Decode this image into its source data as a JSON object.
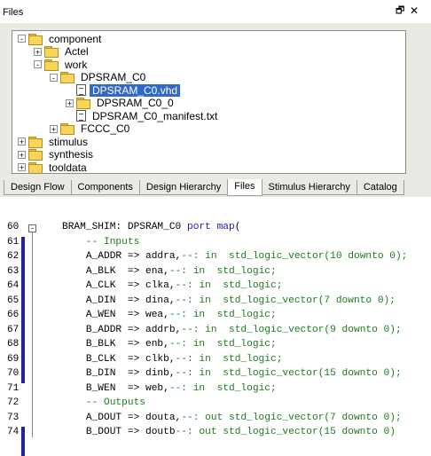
{
  "files_panel": {
    "title": "Files",
    "restore_icon": "restore-icon",
    "close_icon": "close-icon",
    "tree": [
      {
        "label": "component",
        "type": "folder",
        "expander": "-",
        "selected": false
      },
      {
        "label": "Actel",
        "type": "folder",
        "expander": "+",
        "selected": false
      },
      {
        "label": "work",
        "type": "folder",
        "expander": "-",
        "selected": false
      },
      {
        "label": "DPSRAM_C0",
        "type": "folder",
        "expander": "-",
        "selected": false
      },
      {
        "label": "DPSRAM_C0.vhd",
        "type": "file",
        "expander": "",
        "selected": true
      },
      {
        "label": "DPSRAM_C0_0",
        "type": "folder",
        "expander": "+",
        "selected": false
      },
      {
        "label": "DPSRAM_C0_manifest.txt",
        "type": "file",
        "expander": "",
        "selected": false
      },
      {
        "label": "FCCC_C0",
        "type": "folder",
        "expander": "+",
        "selected": false
      },
      {
        "label": "stimulus",
        "type": "folder",
        "expander": "+",
        "selected": false
      },
      {
        "label": "synthesis",
        "type": "folder",
        "expander": "+",
        "selected": false
      },
      {
        "label": "tooldata",
        "type": "folder",
        "expander": "+",
        "selected": false
      }
    ],
    "tabs": [
      "Design Flow",
      "Components",
      "Design Hierarchy",
      "Files",
      "Stimulus Hierarchy",
      "Catalog"
    ],
    "active_tab": "Files"
  },
  "editor": {
    "lines": [
      {
        "num": "60",
        "parts": [
          {
            "t": "BRAM_SHIM: DPSRAM_C0 ",
            "c": "id"
          },
          {
            "t": "port map",
            "c": "kw"
          },
          {
            "t": "(",
            "c": "op"
          }
        ]
      },
      {
        "num": "61",
        "parts": [
          {
            "t": "    -- Inputs",
            "c": "cm"
          }
        ]
      },
      {
        "num": "62",
        "parts": [
          {
            "t": "    A_ADDR => addra,",
            "c": "id"
          },
          {
            "t": "--: in  std_logic_vector(10 downto 0);",
            "c": "cm"
          }
        ]
      },
      {
        "num": "63",
        "parts": [
          {
            "t": "    A_BLK  => ena,",
            "c": "id"
          },
          {
            "t": "--: in  std_logic;",
            "c": "cm"
          }
        ]
      },
      {
        "num": "64",
        "parts": [
          {
            "t": "    A_CLK  => clka,",
            "c": "id"
          },
          {
            "t": "--: in  std_logic;",
            "c": "cm"
          }
        ]
      },
      {
        "num": "65",
        "parts": [
          {
            "t": "    A_DIN  => dina,",
            "c": "id"
          },
          {
            "t": "--: in  std_logic_vector(7 downto 0);",
            "c": "cm"
          }
        ]
      },
      {
        "num": "66",
        "parts": [
          {
            "t": "    A_WEN  => wea,",
            "c": "id"
          },
          {
            "t": "--: in  std_logic;",
            "c": "cm"
          }
        ]
      },
      {
        "num": "67",
        "parts": [
          {
            "t": "    B_ADDR => addrb,",
            "c": "id"
          },
          {
            "t": "--: in  std_logic_vector(9 downto 0);",
            "c": "cm"
          }
        ]
      },
      {
        "num": "68",
        "parts": [
          {
            "t": "    B_BLK  => enb,",
            "c": "id"
          },
          {
            "t": "--: in  std_logic;",
            "c": "cm"
          }
        ]
      },
      {
        "num": "69",
        "parts": [
          {
            "t": "    B_CLK  => clkb,",
            "c": "id"
          },
          {
            "t": "--: in  std_logic;",
            "c": "cm"
          }
        ]
      },
      {
        "num": "70",
        "parts": [
          {
            "t": "    B_DIN  => dinb,",
            "c": "id"
          },
          {
            "t": "--: in  std_logic_vector(15 downto 0);",
            "c": "cm"
          }
        ]
      },
      {
        "num": "71",
        "parts": [
          {
            "t": "    B_WEN  => web,",
            "c": "id"
          },
          {
            "t": "--: in  std_logic;",
            "c": "cm"
          }
        ]
      },
      {
        "num": "72",
        "parts": [
          {
            "t": "    -- Outputs",
            "c": "cm"
          }
        ]
      },
      {
        "num": "73",
        "parts": [
          {
            "t": "    A_DOUT => douta,",
            "c": "id"
          },
          {
            "t": "--: out std_logic_vector(7 downto 0);",
            "c": "cm"
          }
        ]
      },
      {
        "num": "74",
        "parts": [
          {
            "t": "    B_DOUT => doutb",
            "c": "id"
          },
          {
            "t": "--: out std_logic_vector(15 downto 0)",
            "c": "cm"
          }
        ]
      }
    ],
    "fold_marker": "-",
    "colors": {
      "keyword": "#1a1ab8",
      "comment": "#1d7a1d",
      "change_bar": "#24249a",
      "selection": "#3169c6"
    }
  }
}
